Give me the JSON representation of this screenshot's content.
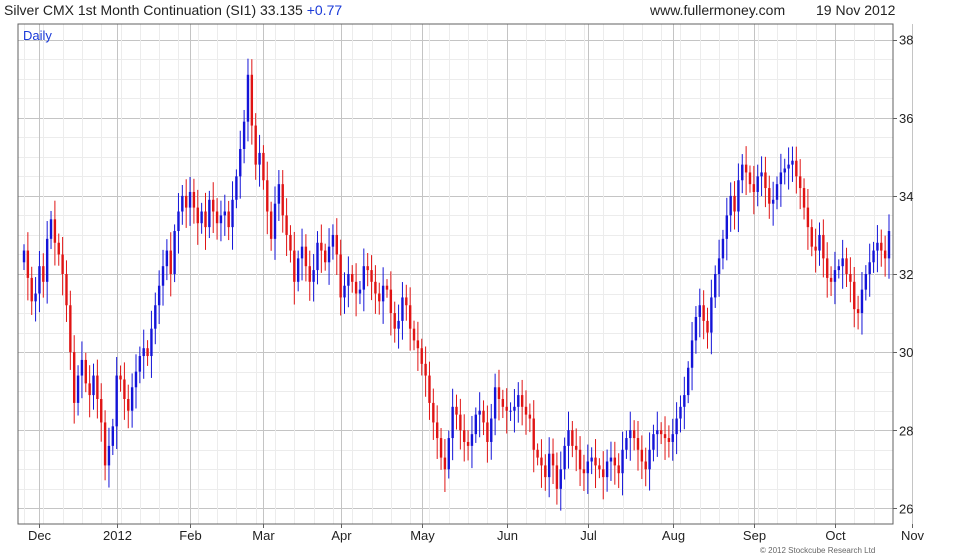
{
  "header": {
    "instrument": "Silver CMX 1st Month Continuation (SI1)",
    "last": "33.135",
    "change": "+0.77",
    "site": "www.fullermoney.com",
    "date": "19 Nov 2012"
  },
  "footer": {
    "credit": "© 2012 Stockcube Research Ltd"
  },
  "colors": {
    "up": "#1414d8",
    "down": "#e01414",
    "grid": "#d2d2d2",
    "frame": "#606060",
    "label_blue": "#1a3ad8"
  },
  "chart_data": {
    "type": "candlestick",
    "frequency_label": "Daily",
    "title": "Silver CMX 1st Month Continuation (SI1)",
    "ylim": [
      25.6,
      38.4
    ],
    "yticks": [
      26,
      28,
      30,
      32,
      34,
      36,
      38
    ],
    "x_axis_labels": [
      "Dec",
      "2012",
      "Feb",
      "Mar",
      "Apr",
      "May",
      "Jun",
      "Jul",
      "Aug",
      "Sep",
      "Oct",
      "Nov"
    ],
    "x_axis_label_index": [
      4,
      24,
      43,
      62,
      82,
      103,
      125,
      146,
      168,
      189,
      210,
      230
    ],
    "grid": true,
    "series": [
      {
        "name": "SI1",
        "close": [
          32.6,
          31.9,
          31.3,
          31.5,
          32.2,
          31.8,
          32.9,
          33.4,
          32.8,
          32.5,
          32.0,
          31.2,
          30.0,
          28.7,
          29.4,
          29.8,
          29.2,
          28.9,
          29.4,
          28.8,
          28.2,
          27.1,
          27.6,
          28.1,
          29.4,
          29.3,
          28.8,
          28.5,
          29.1,
          29.5,
          29.9,
          30.1,
          29.9,
          30.6,
          31.2,
          31.7,
          32.2,
          32.6,
          32.0,
          33.1,
          33.6,
          34.0,
          33.7,
          34.1,
          33.7,
          33.3,
          33.6,
          33.2,
          33.9,
          33.6,
          33.3,
          33.5,
          33.6,
          33.2,
          33.9,
          34.5,
          35.2,
          35.9,
          37.1,
          35.8,
          34.8,
          35.1,
          34.4,
          33.6,
          32.9,
          33.8,
          34.3,
          33.5,
          33.0,
          32.6,
          31.8,
          32.4,
          32.7,
          32.2,
          31.8,
          32.1,
          32.8,
          32.6,
          32.3,
          32.7,
          33.0,
          32.5,
          31.4,
          31.7,
          32.0,
          31.8,
          31.5,
          31.6,
          32.2,
          32.1,
          31.8,
          31.5,
          31.3,
          31.7,
          31.6,
          31.0,
          30.6,
          30.8,
          31.4,
          31.2,
          30.6,
          30.3,
          30.1,
          29.7,
          29.4,
          28.7,
          28.2,
          27.8,
          27.3,
          27.0,
          27.8,
          28.6,
          28.4,
          28.0,
          27.7,
          27.6,
          27.9,
          28.4,
          28.5,
          28.2,
          27.7,
          28.3,
          29.1,
          28.8,
          28.6,
          28.5,
          28.5,
          28.6,
          28.9,
          28.6,
          28.4,
          28.3,
          27.5,
          27.3,
          27.1,
          26.8,
          27.4,
          27.1,
          26.5,
          27.0,
          27.6,
          28.0,
          27.6,
          27.5,
          27.0,
          26.9,
          27.2,
          27.3,
          27.1,
          27.0,
          26.8,
          27.2,
          27.3,
          27.1,
          26.9,
          27.5,
          27.8,
          28.0,
          27.8,
          27.5,
          27.2,
          27.0,
          27.5,
          27.9,
          28.0,
          27.9,
          27.8,
          27.7,
          27.9,
          28.3,
          28.6,
          28.9,
          29.6,
          30.3,
          30.9,
          31.2,
          30.8,
          30.5,
          31.4,
          32.0,
          32.4,
          32.9,
          33.5,
          34.0,
          33.6,
          34.4,
          34.8,
          34.6,
          34.3,
          34.1,
          34.5,
          34.6,
          34.2,
          33.8,
          33.9,
          34.3,
          34.6,
          34.7,
          34.8,
          34.9,
          34.5,
          34.2,
          33.7,
          33.2,
          32.7,
          32.6,
          33.0,
          32.4,
          31.9,
          31.8,
          32.1,
          32.2,
          32.4,
          32.0,
          31.8,
          31.1,
          31.0,
          31.6,
          32.0,
          32.3,
          32.6,
          32.8,
          32.6,
          32.4,
          33.1
        ]
      }
    ]
  }
}
